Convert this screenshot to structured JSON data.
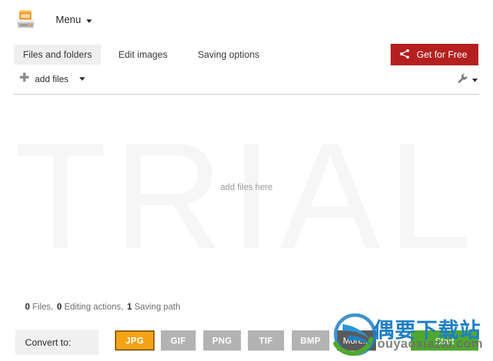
{
  "window": {
    "app_icon": "image-converter-icon",
    "menu_label": "Menu"
  },
  "tabs": [
    {
      "label": "Files and folders",
      "active": true
    },
    {
      "label": "Edit images",
      "active": false
    },
    {
      "label": "Saving options",
      "active": false
    }
  ],
  "cta": {
    "label": "Get for Free",
    "icon": "share-icon",
    "color": "#b41f1f"
  },
  "toolbar": {
    "add_files_label": "add files",
    "add_files_icon": "plus-icon",
    "tools_icon": "wrench-icon"
  },
  "droparea": {
    "watermark": "TRIAL",
    "hint": "add files here"
  },
  "status": {
    "files_count": "0",
    "files_label": "Files,",
    "editing_count": "0",
    "editing_label": "Editing actions,",
    "saving_count": "1",
    "saving_label": "Saving path"
  },
  "bottom": {
    "convert_label": "Convert to:",
    "formats": [
      {
        "label": "JPG",
        "selected": true,
        "style": "selected"
      },
      {
        "label": "GIF",
        "selected": false,
        "style": "normal"
      },
      {
        "label": "PNG",
        "selected": false,
        "style": "normal"
      },
      {
        "label": "TIF",
        "selected": false,
        "style": "normal"
      },
      {
        "label": "BMP",
        "selected": false,
        "style": "normal"
      },
      {
        "label": "More...",
        "selected": false,
        "style": "more"
      }
    ],
    "start_label": "Start",
    "start_color": "#4fa82e",
    "selected_color": "#f5a316"
  },
  "site_watermark": {
    "chinese": "偶要下载站",
    "domain": "ouyaoxiazai.com"
  }
}
